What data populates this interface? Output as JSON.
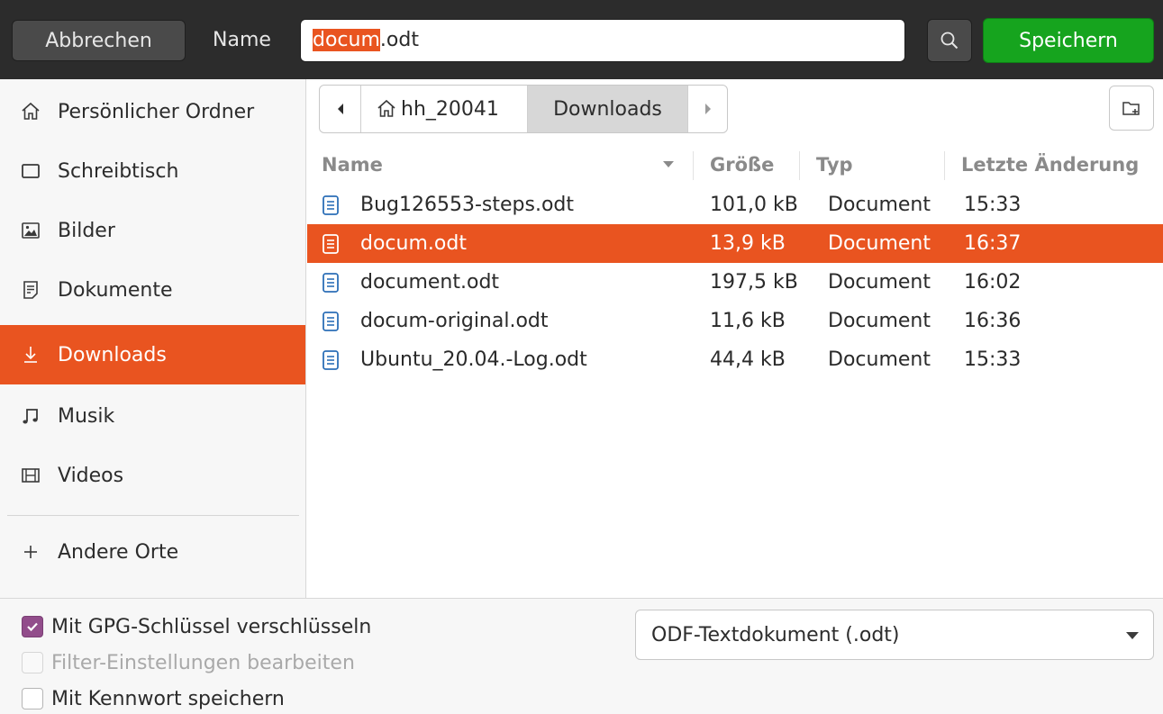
{
  "header": {
    "cancel_label": "Abbrechen",
    "name_label": "Name",
    "filename_selected_part": "docum",
    "filename_rest": ".odt",
    "save_label": "Speichern"
  },
  "sidebar": {
    "items": [
      {
        "label": "Persönlicher Ordner",
        "icon": "home-icon"
      },
      {
        "label": "Schreibtisch",
        "icon": "desktop-icon"
      },
      {
        "label": "Bilder",
        "icon": "pictures-icon"
      },
      {
        "label": "Dokumente",
        "icon": "documents-icon"
      },
      {
        "label": "Downloads",
        "icon": "downloads-icon",
        "active": true
      },
      {
        "label": "Musik",
        "icon": "music-icon"
      },
      {
        "label": "Videos",
        "icon": "videos-icon"
      }
    ],
    "other_locations_label": "Andere Orte"
  },
  "pathbar": {
    "home_label": "hh_20041",
    "current_label": "Downloads"
  },
  "columns": {
    "name": "Name",
    "size": "Größe",
    "type": "Typ",
    "modified": "Letzte Änderung"
  },
  "files": [
    {
      "name": "Bug126553-steps.odt",
      "size": "101,0 kB",
      "type": "Document",
      "modified": "15:33",
      "selected": false
    },
    {
      "name": "docum.odt",
      "size": "13,9 kB",
      "type": "Document",
      "modified": "16:37",
      "selected": true
    },
    {
      "name": "document.odt",
      "size": "197,5 kB",
      "type": "Document",
      "modified": "16:02",
      "selected": false
    },
    {
      "name": "docum-original.odt",
      "size": "11,6 kB",
      "type": "Document",
      "modified": "16:36",
      "selected": false
    },
    {
      "name": "Ubuntu_20.04.-Log.odt",
      "size": "44,4 kB",
      "type": "Document",
      "modified": "15:33",
      "selected": false
    }
  ],
  "options": {
    "gpg_label": "Mit GPG-Schlüssel verschlüsseln",
    "gpg_checked": true,
    "filter_label": "Filter-Einstellungen bearbeiten",
    "filter_enabled": false,
    "password_label": "Mit Kennwort speichern",
    "password_checked": false
  },
  "filetype": {
    "selected": "ODF-Textdokument (.odt)"
  },
  "colors": {
    "accent": "#e95420",
    "save_green": "#16a41e",
    "header_bg": "#2c2c2c",
    "checkbox_purple": "#924d8b"
  }
}
